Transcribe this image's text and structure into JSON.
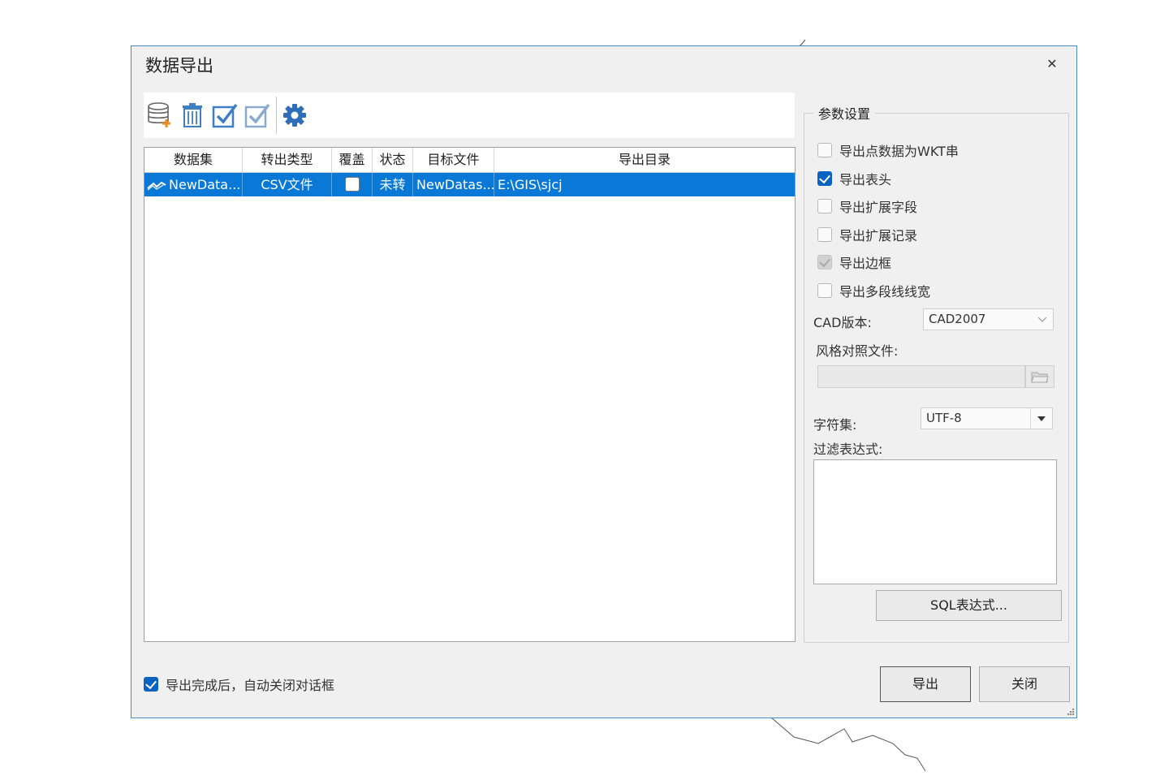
{
  "dialog": {
    "title": "数据导出",
    "close_symbol": "✕"
  },
  "toolbar": {
    "icons": [
      "add-dataset-icon",
      "delete-icon",
      "select-all-icon",
      "invert-select-icon",
      "settings-gear-icon"
    ]
  },
  "grid": {
    "columns": [
      "数据集",
      "转出类型",
      "覆盖",
      "状态",
      "目标文件",
      "导出目录"
    ],
    "rows": [
      {
        "dataset": "NewData...",
        "type": "CSV文件",
        "overwrite": false,
        "status": "未转",
        "target_file": "NewDatas...",
        "directory": "E:\\GIS\\sjcj"
      }
    ]
  },
  "params": {
    "group_title": "参数设置",
    "options": [
      {
        "label": "导出点数据为WKT串",
        "checked": false,
        "disabled": false
      },
      {
        "label": "导出表头",
        "checked": true,
        "disabled": false
      },
      {
        "label": "导出扩展字段",
        "checked": false,
        "disabled": false
      },
      {
        "label": "导出扩展记录",
        "checked": false,
        "disabled": false
      },
      {
        "label": "导出边框",
        "checked": true,
        "disabled": true
      },
      {
        "label": "导出多段线线宽",
        "checked": false,
        "disabled": false
      }
    ],
    "cad_version_label": "CAD版本:",
    "cad_version_value": "CAD2007",
    "style_file_label": "风格对照文件:",
    "style_file_value": "",
    "charset_label": "字符集:",
    "charset_value": "UTF-8",
    "filter_label": "过滤表达式:",
    "filter_value": "",
    "sql_button": "SQL表达式..."
  },
  "footer": {
    "auto_close_label": "导出完成后，自动关闭对话框",
    "auto_close_checked": true,
    "export_button": "导出",
    "close_button": "关闭"
  },
  "colors": {
    "accent": "#0a78d7",
    "checkbox_on": "#0a63c4",
    "dialog_bg": "#f0f0f0",
    "border": "#4a90c8"
  }
}
